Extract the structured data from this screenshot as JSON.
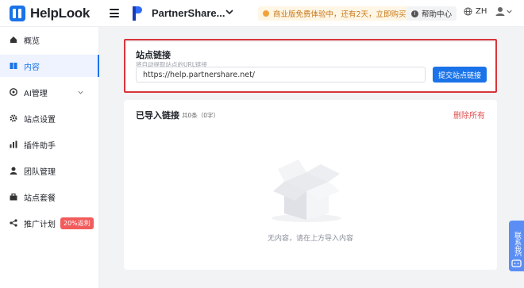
{
  "header": {
    "logo_text": "HelpLook",
    "site_name": "PartnerShare...",
    "trial_banner": "商业版免费体验中，还有2天，立即购买",
    "help_center": "帮助中心",
    "language": "ZH"
  },
  "sidebar": {
    "items": [
      {
        "label": "概览",
        "icon": "home-icon"
      },
      {
        "label": "内容",
        "icon": "book-icon",
        "active": true
      },
      {
        "label": "AI管理",
        "icon": "ai-icon",
        "has_chevron": true
      },
      {
        "label": "站点设置",
        "icon": "gear-icon"
      },
      {
        "label": "插件助手",
        "icon": "chart-icon"
      },
      {
        "label": "团队管理",
        "icon": "team-icon"
      },
      {
        "label": "站点套餐",
        "icon": "bag-icon"
      },
      {
        "label": "推广计划",
        "icon": "share-icon",
        "badge": "20%返利"
      }
    ]
  },
  "import_card": {
    "title": "站点链接",
    "subtitle": "将自动提取站点的URL链接",
    "url_value": "https://help.partnershare.net/",
    "submit_label": "提交站点链接"
  },
  "list_card": {
    "title": "已导入链接",
    "count": "共0条（0字）",
    "delete_all": "删除所有",
    "empty_text": "无内容，请在上方导入内容"
  },
  "feedback_label": "联系我们",
  "colors": {
    "primary": "#1a73e8",
    "danger": "#e05252",
    "highlight_border": "#d7353a",
    "warning_text": "#c7781a"
  }
}
